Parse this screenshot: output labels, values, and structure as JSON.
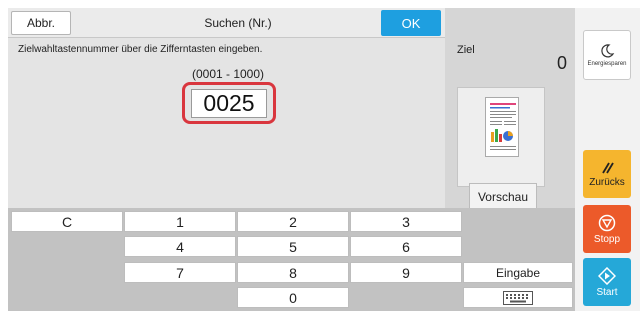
{
  "dialog": {
    "cancel_label": "Abbr.",
    "title": "Suchen (Nr.)",
    "ok_label": "OK",
    "instruction": "Zielwahltastennummer über die Zifferntasten eingeben.",
    "range": "(0001 - 1000)",
    "value": "0025"
  },
  "status_panel": {
    "ziel_label": "Ziel",
    "ziel_count": "0",
    "preview_label": "Vorschau"
  },
  "side_buttons": {
    "energy_label": "Energiesparen",
    "back_label": "Zurücks",
    "stop_label": "Stopp",
    "start_label": "Start"
  },
  "keypad": {
    "clear": "C",
    "k1": "1",
    "k2": "2",
    "k3": "3",
    "k4": "4",
    "k5": "5",
    "k6": "6",
    "k7": "7",
    "k8": "8",
    "k9": "9",
    "k0": "0",
    "enter": "Eingabe"
  },
  "colors": {
    "ok_button": "#1e9fe0",
    "input_highlight": "#d9363e",
    "back_button": "#f5b52e",
    "stop_button": "#ec5a2a",
    "start_button": "#25a8d8"
  },
  "icons": [
    "moon-icon",
    "back-arrows-icon",
    "stop-icon",
    "start-icon",
    "keyboard-icon",
    "document-thumbnail"
  ]
}
